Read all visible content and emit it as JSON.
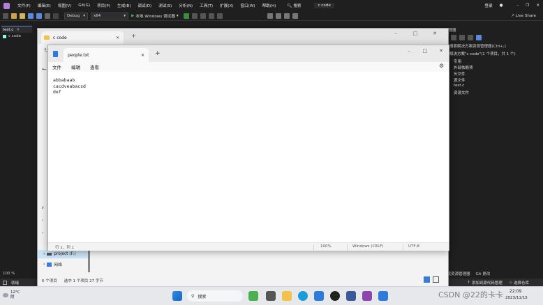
{
  "vs": {
    "menu": [
      "文件(F)",
      "编辑(E)",
      "视图(V)",
      "Git(G)",
      "项目(P)",
      "生成(B)",
      "调试(D)",
      "测试(S)",
      "分析(N)",
      "工具(T)",
      "扩展(X)",
      "窗口(W)",
      "帮助(H)"
    ],
    "search_label": "搜索",
    "title": "c code",
    "login": "登录",
    "live_share": "Live Share",
    "config": "Debug",
    "platform": "x64",
    "run_label": "本地 Windows 调试器",
    "editor_tab": "test.c",
    "editor_sub": "c code",
    "zoom": "100 %",
    "status_text": "就绪",
    "right_title": "解决方案资源管理器",
    "right_search": "搜索解决方案资源管理器(Ctrl+;)",
    "right_solution": "解决方案\"c code\"(1 个项目，共 1 个)",
    "right_items": [
      "c code",
      "引用",
      "外部依赖项",
      "头文件",
      "源文件",
      "test.c",
      "资源文件"
    ],
    "right_tabs": [
      "解决方案资源管理器",
      "Git 更改"
    ],
    "right_status": "添加到源代码管理",
    "right_status2": "选择仓库"
  },
  "explorer": {
    "tab_label": "c code",
    "nav_items": [
      "project (F:)",
      "网络"
    ],
    "status_count": "6 个项目",
    "status_selected": "选中 1 个项目  27 字节"
  },
  "notepad": {
    "tab_label": "people.txt",
    "menu": [
      "文件",
      "编辑",
      "查看"
    ],
    "lines": [
      "abbabaab",
      "cacdveabacsd",
      "def"
    ],
    "status": {
      "position": "行 1，列 1",
      "zoom": "100%",
      "eol": "Windows (CRLF)",
      "encoding": "UTF-8"
    }
  },
  "taskbar": {
    "weather_temp": "12°C",
    "weather_desc": "阴",
    "search": "搜索",
    "time": "22:09",
    "date": "2023/11/15",
    "watermark": "CSDN @22的卡卡"
  }
}
